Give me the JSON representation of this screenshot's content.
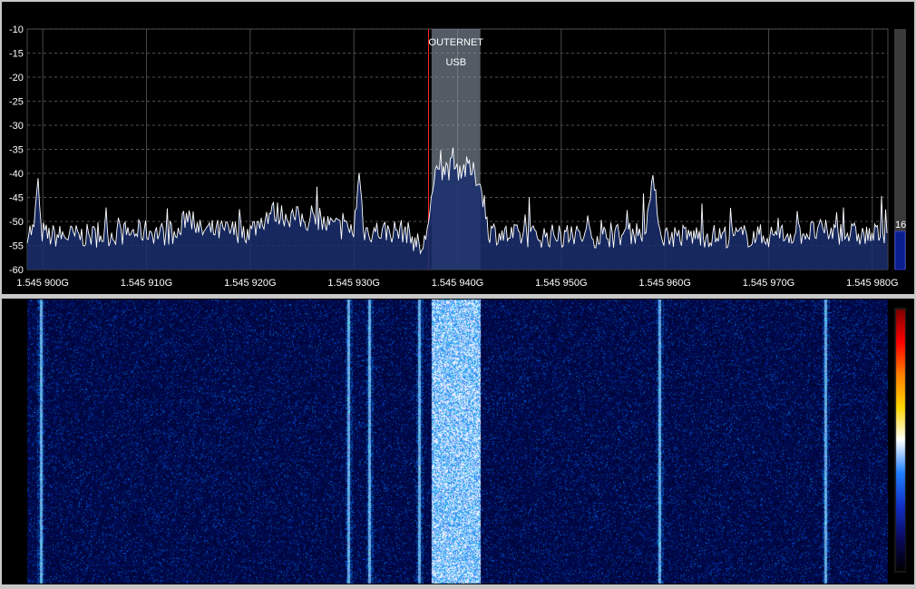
{
  "spectrum": {
    "y_ticks": [
      "-10",
      "-15",
      "-20",
      "-25",
      "-30",
      "-35",
      "-40",
      "-45",
      "-50",
      "-55",
      "-60"
    ],
    "x_ticks": [
      "1.545 900G",
      "1.545 910G",
      "1.545 920G",
      "1.545 930G",
      "1.545 940G",
      "1.545 950G",
      "1.545 960G",
      "1.545 970G",
      "1.545 980G"
    ],
    "vfo": {
      "name": "OUTERNET",
      "mode": "USB"
    },
    "level_value": "16",
    "level_fraction": 0.16
  },
  "colors": {
    "background": "#000000",
    "trace": "#ffffff",
    "fill": "#1a2f6e",
    "vfo_band": "#8a9aa8",
    "vfo_marker": "#ff2020",
    "level_bar": "#0a1e8c"
  },
  "chart_data": {
    "type": "line",
    "title": "",
    "xlabel": "",
    "ylabel": "",
    "xlim": [
      1545898.5,
      1545981.5
    ],
    "ylim": [
      -60,
      -10
    ],
    "units_x": "kHz",
    "series": [
      {
        "x": [
          1545898.5,
          1545899.2,
          1545899.5,
          1545899.8,
          1545900.5,
          1545905,
          1545910,
          1545913,
          1545914,
          1545915,
          1545920,
          1545922,
          1545930,
          1545930.5,
          1545931,
          1545935,
          1545936.7,
          1545937,
          1545937.5,
          1545938,
          1545939,
          1545940,
          1545941,
          1545942,
          1545942.5,
          1545943,
          1545945,
          1545950,
          1545955,
          1545958,
          1545959,
          1545959.5,
          1545960,
          1545965,
          1545970,
          1545975,
          1545980,
          1545981.5
        ],
        "y": [
          -52,
          -52,
          -40,
          -52,
          -53,
          -53,
          -52,
          -53,
          -48,
          -52,
          -52,
          -48,
          -52,
          -40,
          -52,
          -52,
          -56,
          -52,
          -45,
          -40,
          -39,
          -39,
          -39,
          -41,
          -45,
          -52,
          -53,
          -53,
          -53,
          -52,
          -41,
          -52,
          -53,
          -53,
          -53,
          -52,
          -53,
          -52
        ]
      }
    ]
  },
  "waterfall": {
    "signal_columns_khz": [
      1545899.8,
      1545929.5,
      1545931.5,
      1545936.3,
      1545959.5,
      1545975.5
    ],
    "band_khz": [
      1545937.5,
      1545942.2
    ],
    "colorbar": [
      "#000000",
      "#0a0a60",
      "#1030c8",
      "#2080ff",
      "#ffffff",
      "#ffd700",
      "#ff8000",
      "#ff0000",
      "#800000"
    ]
  }
}
